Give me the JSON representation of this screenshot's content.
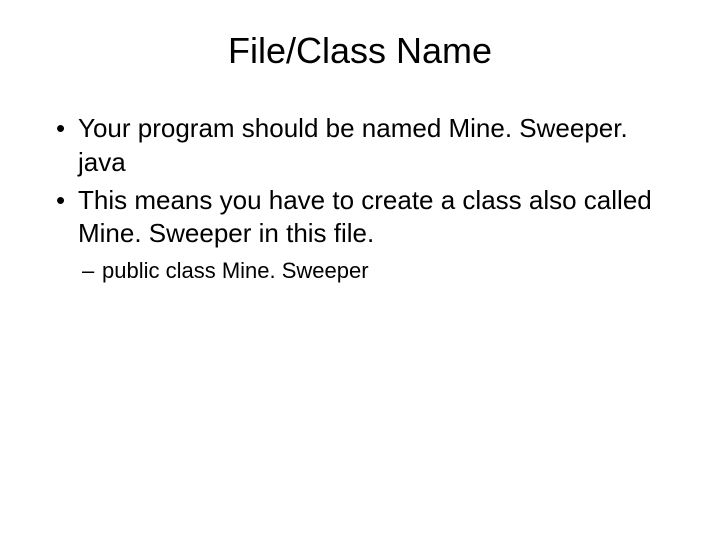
{
  "slide": {
    "title": "File/Class Name",
    "bullets": [
      "Your program should be named Mine. Sweeper. java",
      "This means you have to create a class also called Mine. Sweeper in this file."
    ],
    "subBullets": [
      "public class Mine. Sweeper"
    ]
  }
}
